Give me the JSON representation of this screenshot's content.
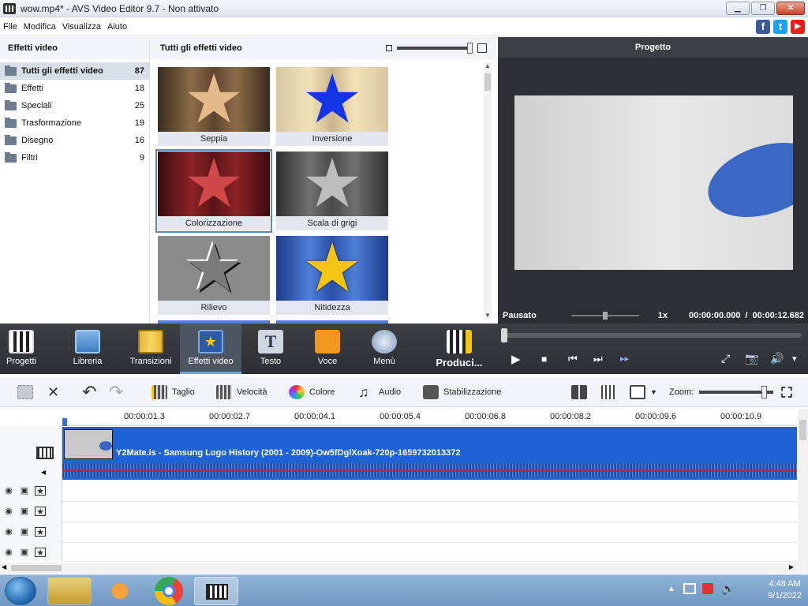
{
  "window": {
    "title": "wow.mp4* - AVS Video Editor 9.7 - Non attivato",
    "btn_min": "▁",
    "btn_max": "❐",
    "btn_close": "✕"
  },
  "menu": [
    "File",
    "Modifica",
    "Visualizza",
    "Aiuto"
  ],
  "social": {
    "facebook": "f",
    "twitter": "t",
    "youtube": "▶"
  },
  "left_panel": {
    "header": "Effetti video",
    "categories": [
      {
        "name": "Tutti gli effetti video",
        "count": "87"
      },
      {
        "name": "Effetti",
        "count": "18"
      },
      {
        "name": "Speciali",
        "count": "25"
      },
      {
        "name": "Trasformazione",
        "count": "19"
      },
      {
        "name": "Disegno",
        "count": "16"
      },
      {
        "name": "Filtri",
        "count": "9"
      }
    ]
  },
  "middle_panel": {
    "header": "Tutti gli effetti video",
    "effects": [
      {
        "label": "Seppia"
      },
      {
        "label": "Inversione"
      },
      {
        "label": "Colorizzazione"
      },
      {
        "label": "Scala di grigi"
      },
      {
        "label": "Rilievo"
      },
      {
        "label": "Nitidezza"
      }
    ]
  },
  "preview": {
    "header": "Progetto",
    "state": "Pausato",
    "speed": "1x",
    "time_current": "00:00:00.000",
    "time_sep": "/",
    "time_total": "00:00:12.682"
  },
  "toolstrip": {
    "items": [
      "Progetti",
      "Libreria",
      "Transizioni",
      "Effetti video",
      "Testo",
      "Voce",
      "Menù",
      "Produci..."
    ],
    "play": "▶",
    "stop": "■",
    "prev": "⏮",
    "next": "⏭",
    "frame": "▸▸",
    "fullscreen": "⤢",
    "snapshot": "📷",
    "volume": "🔊",
    "vol_menu": "▾"
  },
  "editbar": {
    "cut": "Taglio",
    "speed": "Velocità",
    "color": "Colore",
    "audio": "Audio",
    "stabilize": "Stabilizzazione",
    "zoom": "Zoom:",
    "delete": "✕",
    "undo": "↶",
    "redo": "↷"
  },
  "timeline": {
    "ticks": [
      "00:00:01.3",
      "00:00:02.7",
      "00:00:04.1",
      "00:00:05.4",
      "00:00:06.8",
      "00:00:08.2",
      "00:00:09.6",
      "00:00:10.9"
    ],
    "clip_name": "Y2Mate.is - Samsung Logo History (2001 - 2009)-Ow5fDglXoak-720p-1659732013372"
  },
  "taskbar": {
    "time": "4:48 AM",
    "date": "9/1/2022"
  },
  "colors": {
    "accent": "#1e63d6",
    "toolstrip": "#2b2e32",
    "audio_line": "#d02020"
  }
}
